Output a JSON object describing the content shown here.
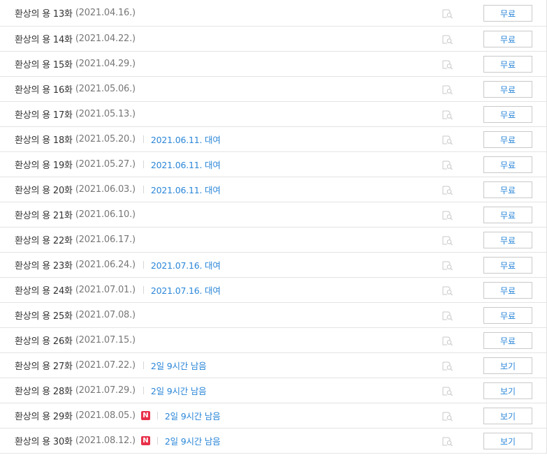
{
  "episodes": [
    {
      "title": "환상의 용 13화",
      "date": "(2021.04.16.)",
      "status": "",
      "new": false,
      "button": "무료"
    },
    {
      "title": "환상의 용 14화",
      "date": "(2021.04.22.)",
      "status": "",
      "new": false,
      "button": "무료"
    },
    {
      "title": "환상의 용 15화",
      "date": "(2021.04.29.)",
      "status": "",
      "new": false,
      "button": "무료"
    },
    {
      "title": "환상의 용 16화",
      "date": "(2021.05.06.)",
      "status": "",
      "new": false,
      "button": "무료"
    },
    {
      "title": "환상의 용 17화",
      "date": "(2021.05.13.)",
      "status": "",
      "new": false,
      "button": "무료"
    },
    {
      "title": "환상의 용 18화",
      "date": "(2021.05.20.)",
      "status": "2021.06.11. 대여",
      "new": false,
      "button": "무료"
    },
    {
      "title": "환상의 용 19화",
      "date": "(2021.05.27.)",
      "status": "2021.06.11. 대여",
      "new": false,
      "button": "무료"
    },
    {
      "title": "환상의 용 20화",
      "date": "(2021.06.03.)",
      "status": "2021.06.11. 대여",
      "new": false,
      "button": "무료"
    },
    {
      "title": "환상의 용 21화",
      "date": "(2021.06.10.)",
      "status": "",
      "new": false,
      "button": "무료"
    },
    {
      "title": "환상의 용 22화",
      "date": "(2021.06.17.)",
      "status": "",
      "new": false,
      "button": "무료"
    },
    {
      "title": "환상의 용 23화",
      "date": "(2021.06.24.)",
      "status": "2021.07.16. 대여",
      "new": false,
      "button": "무료"
    },
    {
      "title": "환상의 용 24화",
      "date": "(2021.07.01.)",
      "status": "2021.07.16. 대여",
      "new": false,
      "button": "무료"
    },
    {
      "title": "환상의 용 25화",
      "date": "(2021.07.08.)",
      "status": "",
      "new": false,
      "button": "무료"
    },
    {
      "title": "환상의 용 26화",
      "date": "(2021.07.15.)",
      "status": "",
      "new": false,
      "button": "무료"
    },
    {
      "title": "환상의 용 27화",
      "date": "(2021.07.22.)",
      "status": "2일 9시간 남음",
      "new": false,
      "button": "보기"
    },
    {
      "title": "환상의 용 28화",
      "date": "(2021.07.29.)",
      "status": "2일 9시간 남음",
      "new": false,
      "button": "보기"
    },
    {
      "title": "환상의 용 29화",
      "date": "(2021.08.05.)",
      "status": "2일 9시간 남음",
      "new": true,
      "button": "보기"
    },
    {
      "title": "환상의 용 30화",
      "date": "(2021.08.12.)",
      "status": "2일 9시간 남음",
      "new": true,
      "button": "보기"
    }
  ],
  "new_badge": "N",
  "icons": {
    "preview": "preview-search-icon"
  },
  "colors": {
    "link": "#2a86d8",
    "badge": "#e8304a",
    "border": "#e3e3e3"
  }
}
